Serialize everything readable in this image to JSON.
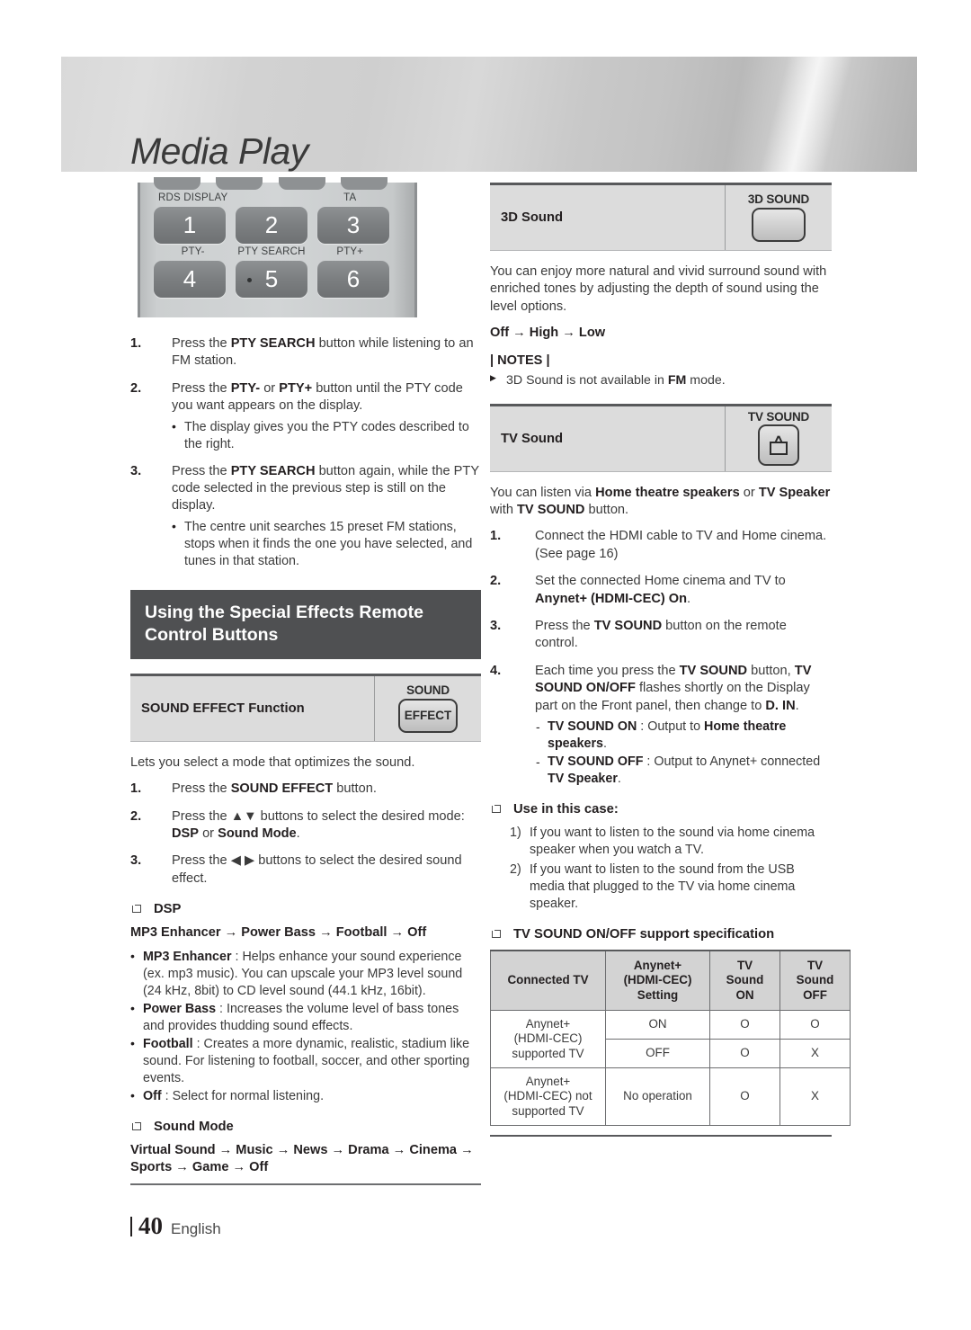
{
  "header": {
    "title": "Media Play"
  },
  "remote": {
    "row1_labels": [
      "RDS DISPLAY",
      "",
      "TA"
    ],
    "row2_labels": [
      "PTY-",
      "PTY SEARCH",
      "PTY+"
    ],
    "row1_buttons": [
      "1",
      "2",
      "3"
    ],
    "row2_buttons": [
      "4",
      "5",
      "6"
    ]
  },
  "left": {
    "pty_steps": [
      {
        "num": "1.",
        "parts": [
          {
            "t": "Press the ",
            "b": false
          },
          {
            "t": "PTY SEARCH",
            "b": true
          },
          {
            "t": " button while listening to an FM station.",
            "b": false
          }
        ],
        "subs": []
      },
      {
        "num": "2.",
        "parts": [
          {
            "t": "Press the ",
            "b": false
          },
          {
            "t": "PTY-",
            "b": true
          },
          {
            "t": " or ",
            "b": false
          },
          {
            "t": "PTY+",
            "b": true
          },
          {
            "t": " button until the PTY code you want appears on the display.",
            "b": false
          }
        ],
        "subs": [
          [
            {
              "t": "The display gives you the PTY codes described to the right.",
              "b": false
            }
          ]
        ]
      },
      {
        "num": "3.",
        "parts": [
          {
            "t": "Press the ",
            "b": false
          },
          {
            "t": "PTY SEARCH",
            "b": true
          },
          {
            "t": " button again, while the PTY code selected in the previous step is still on the display.",
            "b": false
          }
        ],
        "subs": [
          [
            {
              "t": "The centre unit searches 15 preset FM stations, stops when it finds the one you have selected, and tunes in that station.",
              "b": false
            }
          ]
        ]
      }
    ],
    "section_heading": "Using the Special Effects Remote Control Buttons",
    "sound_effect_box": {
      "label": "SOUND EFFECT Function",
      "icon_caption": "SOUND",
      "icon_label": "EFFECT"
    },
    "sound_effect_intro": "Lets you select a mode that optimizes the sound.",
    "sound_effect_steps": [
      {
        "num": "1.",
        "parts": [
          {
            "t": "Press the ",
            "b": false
          },
          {
            "t": "SOUND EFFECT",
            "b": true
          },
          {
            "t": " button.",
            "b": false
          }
        ],
        "subs": []
      },
      {
        "num": "2.",
        "parts": [
          {
            "t": "Press the ",
            "b": false
          },
          {
            "t": "▲▼",
            "b": false
          },
          {
            "t": " buttons to select the desired mode: ",
            "b": false
          },
          {
            "t": "DSP",
            "b": true
          },
          {
            "t": " or ",
            "b": false
          },
          {
            "t": "Sound Mode",
            "b": true
          },
          {
            "t": ".",
            "b": false
          }
        ],
        "subs": []
      },
      {
        "num": "3.",
        "parts": [
          {
            "t": "Press the ",
            "b": false
          },
          {
            "t": "◀ ▶",
            "b": false
          },
          {
            "t": " buttons to select the desired sound effect.",
            "b": false
          }
        ],
        "subs": []
      }
    ],
    "dsp_heading": "DSP",
    "dsp_chain": "MP3 Enhancer → Power Bass → Football → Off",
    "dsp_items": [
      [
        {
          "t": "MP3 Enhancer",
          "b": true
        },
        {
          "t": " : Helps enhance your sound experience (ex. mp3 music). You can upscale your MP3 level sound (24 kHz, 8bit) to CD level sound (44.1 kHz, 16bit).",
          "b": false
        }
      ],
      [
        {
          "t": "Power Bass",
          "b": true
        },
        {
          "t": " : Increases the volume level of bass tones and provides thudding sound effects.",
          "b": false
        }
      ],
      [
        {
          "t": "Football",
          "b": true
        },
        {
          "t": " : Creates a more dynamic, realistic, stadium like sound. For listening to football, soccer, and other sporting events.",
          "b": false
        }
      ],
      [
        {
          "t": "Off",
          "b": true
        },
        {
          "t": " : Select for normal listening.",
          "b": false
        }
      ]
    ],
    "sound_mode_heading": "Sound Mode",
    "sound_mode_chain": "Virtual Sound → Music → News → Drama → Cinema → Sports → Game → Off"
  },
  "right": {
    "sound3d_box": {
      "label": "3D Sound",
      "icon_caption": "3D SOUND"
    },
    "sound3d_desc": "You can enjoy more natural and vivid surround sound with enriched tones by adjusting the depth of sound using the level options.",
    "sound3d_chain": "Off → High → Low",
    "notes_title": "| NOTES |",
    "notes_items": [
      [
        {
          "t": "3D Sound is not available in ",
          "b": false
        },
        {
          "t": "FM",
          "b": true
        },
        {
          "t": " mode.",
          "b": false
        }
      ]
    ],
    "tvsound_box": {
      "label": "TV Sound",
      "icon_caption": "TV SOUND"
    },
    "tvsound_desc": [
      {
        "t": "You can listen via ",
        "b": false
      },
      {
        "t": "Home theatre speakers",
        "b": true
      },
      {
        "t": " or ",
        "b": false
      },
      {
        "t": "TV Speaker",
        "b": true
      },
      {
        "t": " with ",
        "b": false
      },
      {
        "t": "TV SOUND",
        "b": true
      },
      {
        "t": " button.",
        "b": false
      }
    ],
    "tvsound_steps": [
      {
        "num": "1.",
        "parts": [
          {
            "t": "Connect the HDMI cable to TV and Home cinema. (See page 16)",
            "b": false
          }
        ],
        "subs": []
      },
      {
        "num": "2.",
        "parts": [
          {
            "t": "Set the connected Home cinema and TV to ",
            "b": false
          },
          {
            "t": "Anynet+ (HDMI-CEC) On",
            "b": true
          },
          {
            "t": ".",
            "b": false
          }
        ],
        "subs": []
      },
      {
        "num": "3.",
        "parts": [
          {
            "t": "Press the ",
            "b": false
          },
          {
            "t": "TV SOUND",
            "b": true
          },
          {
            "t": " button on the remote control.",
            "b": false
          }
        ],
        "subs": []
      },
      {
        "num": "4.",
        "parts": [
          {
            "t": "Each time you press the ",
            "b": false
          },
          {
            "t": "TV SOUND",
            "b": true
          },
          {
            "t": " button, ",
            "b": false
          },
          {
            "t": "TV SOUND ON/OFF",
            "b": true
          },
          {
            "t": " flashes shortly on the Display part on the Front panel, then change to ",
            "b": false
          },
          {
            "t": "D. IN",
            "b": true
          },
          {
            "t": ".",
            "b": false
          }
        ],
        "subs": [
          [
            {
              "t": "TV SOUND ON",
              "b": true
            },
            {
              "t": " : Output to ",
              "b": false
            },
            {
              "t": "Home theatre speakers",
              "b": true
            },
            {
              "t": ".",
              "b": false
            }
          ],
          [
            {
              "t": "TV SOUND OFF",
              "b": true
            },
            {
              "t": " : Output to Anynet+ connected ",
              "b": false
            },
            {
              "t": "TV Speaker",
              "b": true
            },
            {
              "t": ".",
              "b": false
            }
          ]
        ]
      }
    ],
    "use_case_heading": "Use in this case:",
    "use_cases": [
      {
        "n": "1)",
        "text": "If you want to listen to the sound via home cinema speaker when you watch a TV."
      },
      {
        "n": "2)",
        "text": "If you want to listen to the sound from the USB media that plugged to the TV via home cinema speaker."
      }
    ],
    "spec_heading": "TV SOUND ON/OFF support specification",
    "spec_table": {
      "headers": [
        "Connected TV",
        "Anynet+ (HDMI-CEC) Setting",
        "TV Sound ON",
        "TV Sound OFF"
      ],
      "headers_lines": [
        [
          "Connected TV"
        ],
        [
          "Anynet+",
          "(HDMI-CEC)",
          "Setting"
        ],
        [
          "TV",
          "Sound",
          "ON"
        ],
        [
          "TV",
          "Sound",
          "OFF"
        ]
      ],
      "rows": [
        {
          "connected_tv_lines": [
            "Anynet+",
            "(HDMI-CEC)",
            "supported TV"
          ],
          "connected_tv_rowspan": 2,
          "setting": "ON",
          "on": "O",
          "off": "O"
        },
        {
          "setting": "OFF",
          "on": "O",
          "off": "X"
        },
        {
          "connected_tv_lines": [
            "Anynet+",
            "(HDMI-CEC) not",
            "supported TV"
          ],
          "connected_tv_rowspan": 1,
          "setting": "No operation",
          "on": "O",
          "off": "X"
        }
      ]
    }
  },
  "footer": {
    "page_number": "40",
    "language": "English"
  }
}
